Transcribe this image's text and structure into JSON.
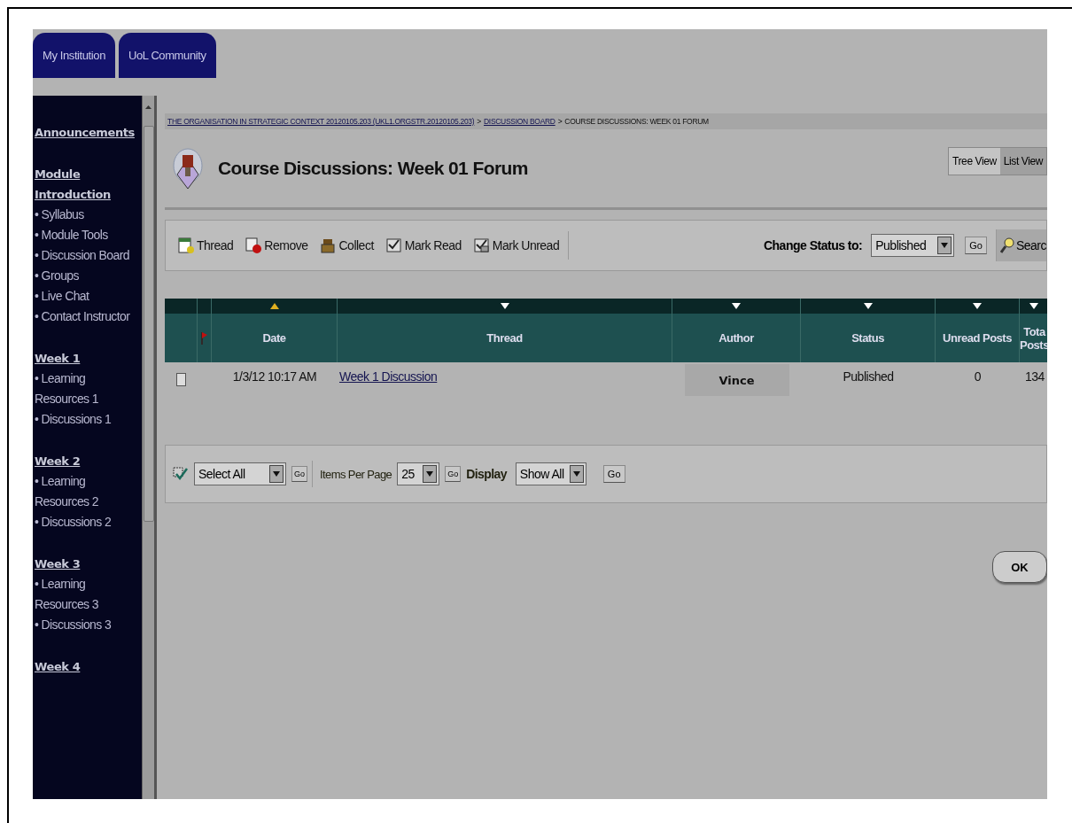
{
  "tabs": [
    {
      "label": "My Institution",
      "selected": false
    },
    {
      "label": "UoL Community",
      "selected": false
    }
  ],
  "sidebar": {
    "sections": [
      {
        "heading": "Announcements"
      },
      {
        "heading": "Module Introduction",
        "items": [
          "• Syllabus",
          "• Module Tools",
          "• Discussion Board",
          "• Groups",
          "• Live Chat",
          "• Contact Instructor"
        ]
      },
      {
        "heading": "Week 1",
        "items": [
          "• Learning Resources 1",
          "• Discussions 1"
        ]
      },
      {
        "heading": "Week 2",
        "items": [
          "• Learning Resources 2",
          "• Discussions 2"
        ]
      },
      {
        "heading": "Week 3",
        "items": [
          "• Learning Resources 3",
          "• Discussions 3"
        ]
      },
      {
        "heading": "Week 4"
      }
    ]
  },
  "breadcrumb": {
    "separator": ">",
    "items": [
      {
        "text": "THE ORGANISATION IN STRATEGIC CONTEXT 20120105.203 (UKL1.ORGSTR.20120105.203)",
        "link": true
      },
      {
        "text": "DISCUSSION BOARD",
        "link": true
      },
      {
        "text": "COURSE DISCUSSIONS: WEEK 01 FORUM",
        "link": false
      }
    ]
  },
  "page_title": "Course Discussions: Week 01 Forum",
  "view_toggle": [
    {
      "label": "Tree View",
      "selected": false
    },
    {
      "label": "List View",
      "selected": true
    }
  ],
  "toolbar": {
    "actions": [
      {
        "kind": "thread",
        "label": "Thread"
      },
      {
        "kind": "remove",
        "label": "Remove"
      },
      {
        "kind": "collect",
        "label": "Collect"
      },
      {
        "kind": "mark-read",
        "label": "Mark Read"
      },
      {
        "kind": "mark-unread",
        "label": "Mark Unread"
      }
    ],
    "status_label": "Change Status to:",
    "status_value": "Published",
    "go": "Go",
    "search": "Searc"
  },
  "table": {
    "columns": [
      {
        "kind": "checkbox"
      },
      {
        "kind": "flag"
      },
      {
        "kind": "text",
        "label": "Date",
        "sorted": true
      },
      {
        "kind": "text",
        "label": "Thread",
        "sorted": false
      },
      {
        "kind": "text",
        "label": "Author",
        "sorted": false
      },
      {
        "kind": "text",
        "label": "Status",
        "sorted": false
      },
      {
        "kind": "text",
        "label": "Unread Posts",
        "sorted": false
      },
      {
        "kind": "text",
        "label": "Tota Posts",
        "sorted": false
      }
    ],
    "rows": [
      {
        "checked": false,
        "date": "1/3/12 10:17 AM",
        "thread": "Week 1 Discussion",
        "author": "Vince",
        "status": "Published",
        "unread_posts": "0",
        "total_posts": "134"
      }
    ]
  },
  "bottom_bar": {
    "select_value": "Select All",
    "select_go": "Go",
    "items_label": "Items Per Page",
    "items_value": "25",
    "items_go": "Go",
    "display_label": "Display",
    "display_value": "Show All",
    "display_go": "Go"
  },
  "ok_button": "OK"
}
